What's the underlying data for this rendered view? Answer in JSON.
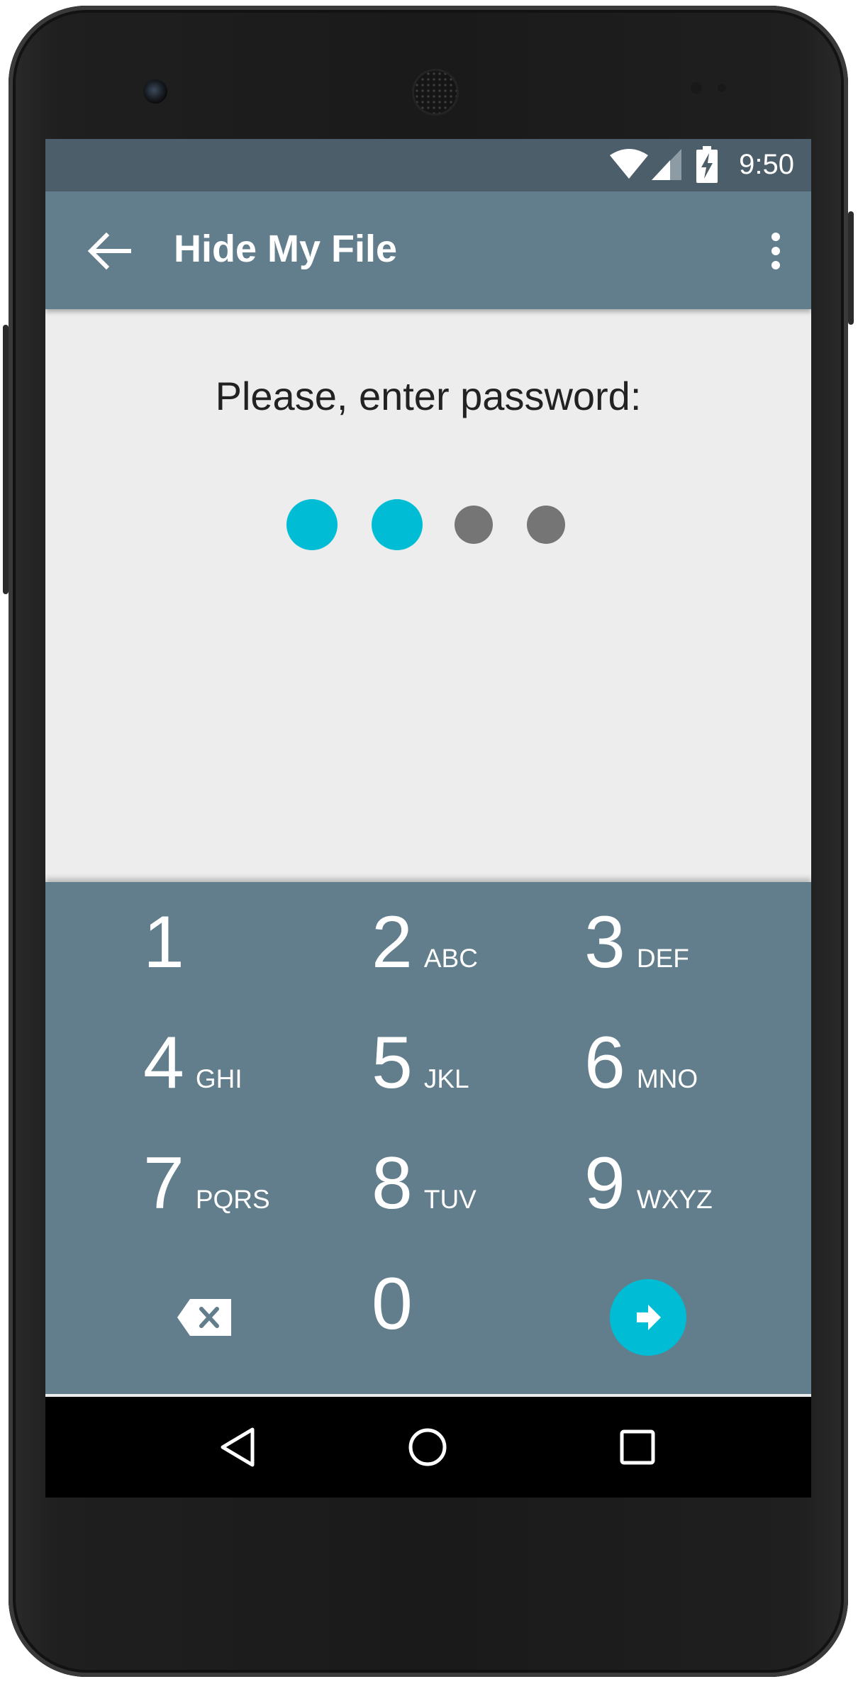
{
  "status_bar": {
    "time": "9:50",
    "icons": [
      "wifi-icon",
      "cell-signal-icon",
      "battery-charging-icon"
    ]
  },
  "app_bar": {
    "title": "Hide My File",
    "back_icon": "arrow-back-icon",
    "menu_icon": "more-vert-icon"
  },
  "password": {
    "prompt": "Please, enter password:",
    "length": 4,
    "entered": 2,
    "filled_color": "#00bcd4",
    "empty_color": "#757575"
  },
  "keypad": {
    "keys": [
      {
        "digit": "1",
        "letters": ""
      },
      {
        "digit": "2",
        "letters": "ABC"
      },
      {
        "digit": "3",
        "letters": "DEF"
      },
      {
        "digit": "4",
        "letters": "GHI"
      },
      {
        "digit": "5",
        "letters": "JKL"
      },
      {
        "digit": "6",
        "letters": "MNO"
      },
      {
        "digit": "7",
        "letters": "PQRS"
      },
      {
        "digit": "8",
        "letters": "TUV"
      },
      {
        "digit": "9",
        "letters": "WXYZ"
      },
      {
        "digit": "0",
        "letters": ""
      }
    ],
    "delete_icon": "backspace-icon",
    "submit_icon": "arrow-forward-icon",
    "submit_color": "#00bcd4",
    "background_color": "#627d8b"
  },
  "nav_bar": {
    "icons": [
      "nav-back-icon",
      "nav-home-icon",
      "nav-recents-icon"
    ]
  }
}
